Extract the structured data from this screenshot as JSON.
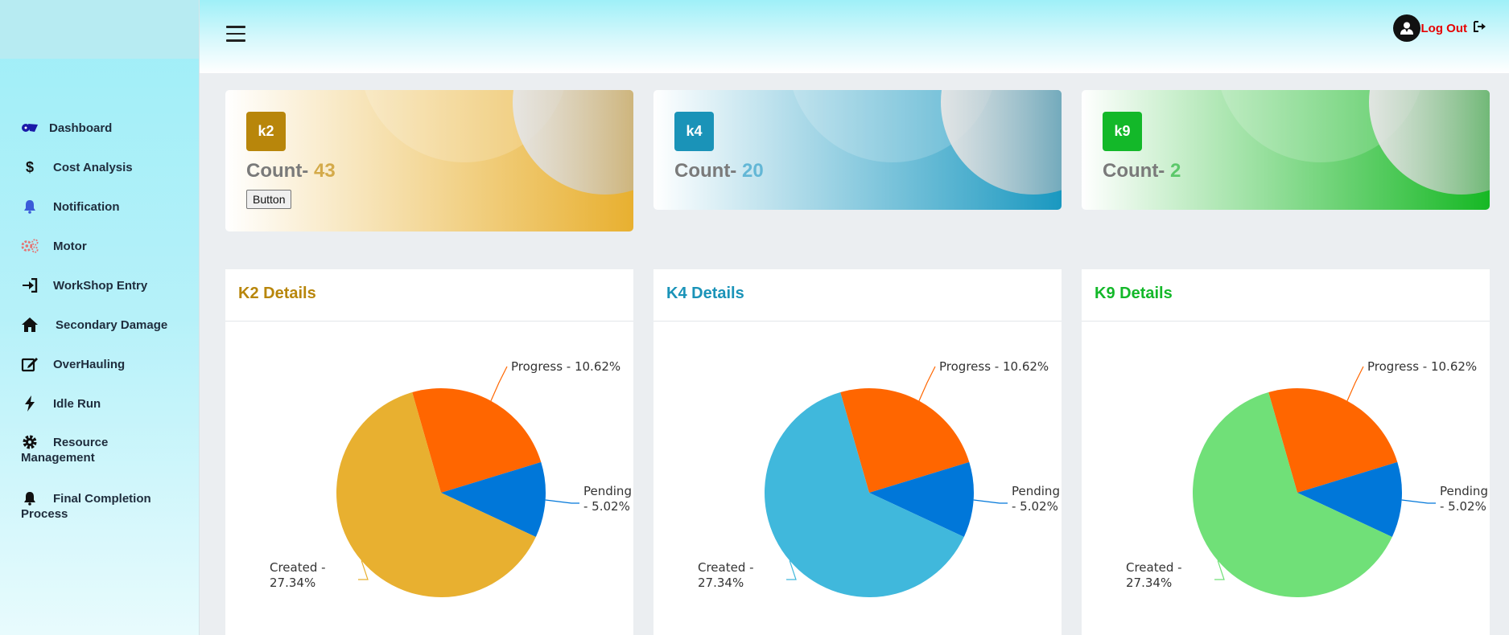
{
  "sidebar": {
    "items": [
      {
        "label": "Dashboard",
        "icon": "dashboard-icon"
      },
      {
        "label": "Cost Analysis",
        "icon": "dollar-icon"
      },
      {
        "label": "Notification",
        "icon": "bell-icon"
      },
      {
        "label": "Motor",
        "icon": "gears-icon"
      },
      {
        "label": "WorkShop Entry",
        "icon": "sign-in-icon"
      },
      {
        "label": "Secondary Damage",
        "icon": "home-icon"
      },
      {
        "label": "OverHauling",
        "icon": "edit-icon"
      },
      {
        "label": "Idle Run",
        "icon": "bolt-icon"
      },
      {
        "label": "Resource",
        "label2": "Management",
        "icon": "gear-icon"
      },
      {
        "label": "Final Completion",
        "label2": "Process",
        "icon": "bell-icon"
      }
    ]
  },
  "topbar": {
    "logout_label": "Log Out",
    "colors": {
      "logout": "#e60000"
    }
  },
  "cards": [
    {
      "badge": "k2",
      "count_label": "Count-",
      "count_value": "43",
      "button_label": "Button",
      "badge_color": "#b8860b",
      "value_color": "#d4aa4a",
      "gradient_to": "#e8b030"
    },
    {
      "badge": "k4",
      "count_label": "Count-",
      "count_value": "20",
      "badge_color": "#1a93b8",
      "value_color": "#63b7d6",
      "gradient_to": "#1a98c0"
    },
    {
      "badge": "k9",
      "count_label": "Count-",
      "count_value": "2",
      "badge_color": "#13b829",
      "value_color": "#5cc86a",
      "gradient_to": "#16b824"
    }
  ],
  "details": [
    {
      "title": "K2 Details",
      "title_color": "#b8860b",
      "created_color": "#e8b030"
    },
    {
      "title": "K4 Details",
      "title_color": "#1a93b8",
      "created_color": "#40b8dc"
    },
    {
      "title": "K9 Details",
      "title_color": "#13b829",
      "created_color": "#70e078"
    }
  ],
  "chart_data": [
    {
      "type": "pie",
      "title": "K2 Details",
      "slices": [
        {
          "label": "Progress - 10.62%",
          "value": 10.62,
          "color": "#ff6600"
        },
        {
          "label": "Pending - 5.02%",
          "value": 5.02,
          "color": "#0077d9"
        },
        {
          "label": "Created - 27.34%",
          "value": 27.34,
          "color": "#e8b030"
        }
      ]
    },
    {
      "type": "pie",
      "title": "K4 Details",
      "slices": [
        {
          "label": "Progress - 10.62%",
          "value": 10.62,
          "color": "#ff6600"
        },
        {
          "label": "Pending - 5.02%",
          "value": 5.02,
          "color": "#0077d9"
        },
        {
          "label": "Created - 27.34%",
          "value": 27.34,
          "color": "#40b8dc"
        }
      ]
    },
    {
      "type": "pie",
      "title": "K9 Details",
      "slices": [
        {
          "label": "Progress - 10.62%",
          "value": 10.62,
          "color": "#ff6600"
        },
        {
          "label": "Pending - 5.02%",
          "value": 5.02,
          "color": "#0077d9"
        },
        {
          "label": "Created - 27.34%",
          "value": 27.34,
          "color": "#70e078"
        }
      ]
    }
  ]
}
